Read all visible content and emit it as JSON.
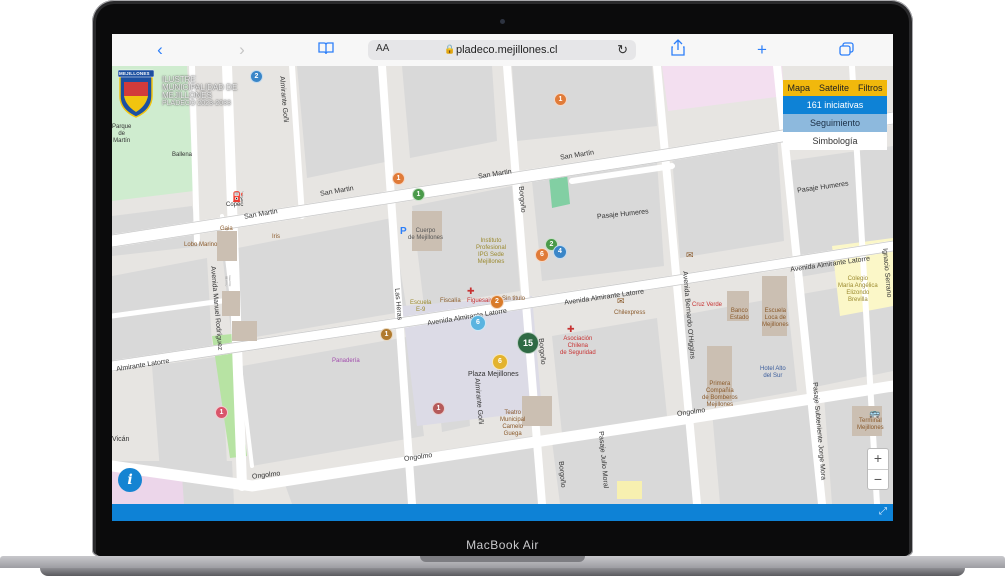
{
  "browser": {
    "url_host": "pladeco.mejillones.cl",
    "text_size_label": "AA"
  },
  "device": {
    "brand": "MacBook Air"
  },
  "logo": {
    "banner": "MEJILLONES",
    "lines": [
      "ILUSTRE",
      "MUNICIPALIDAD DE",
      "MEJILLONES",
      "PLADECO 2023-2033"
    ]
  },
  "panel": {
    "tabs": [
      "Mapa",
      "Satelite",
      "Filtros"
    ],
    "initiatives": "161 iniciativas",
    "tracking": "Seguimiento",
    "legend": "Simbología"
  },
  "map": {
    "streets": {
      "san_martin_1": "San Martin",
      "san_martin_2": "San Martin",
      "san_martin_3": "San Martin",
      "san_martin_4": "San Martín",
      "pasaje_humeres_1": "Pasaje Humeres",
      "pasaje_humeres_2": "Pasaje Humeres",
      "almirante_latorre_1": "Avenida Almirante Latorre",
      "almirante_latorre_2": "Avenida Almirante Latorre",
      "almirante_latorre_3": "Avenida Almirante Latorre",
      "almirante_latorre_4": "Almirante Latorre",
      "ongolmo_1": "Ongolmo",
      "ongolmo_2": "Ongolmo",
      "ongolmo_3": "Ongolmo",
      "borgono_1": "Borgoño",
      "borgono_2": "Borgoño",
      "borgono_3": "Borgoño",
      "las_heras": "Las Heras",
      "manuel_rodriguez": "Avenida Manuel Rodríguez",
      "gorki": "Almirante Goñi",
      "almirante_goni": "Almirante Goñi",
      "bernardo_ohiggins": "Avenida Bernardo O'Higgins",
      "julio_moral": "Pasaje Julio Moral",
      "subteniente": "Pasaje Subteniente Jorge Mora",
      "ignacio": "Ignacio Serrano",
      "vican": "Vicán"
    },
    "pois": {
      "parque": "Parque\nde\nMartín",
      "ballena": "Ballena",
      "copec": "Copec",
      "gaia": "Gaia",
      "lobo_marino": "Lobo Marino",
      "iris": "Iris",
      "instituto": "Instituto\nProfesional\nIPG Sede\nMejillones",
      "escuela": "Escuela\nE-9",
      "fiscalia": "Fiscalía",
      "figuesain": "Figuesain",
      "sin_titulo": "Sin titulo",
      "chilexpress": "Chilexpress",
      "cruz_verde": "Cruz Verde",
      "banco_estado": "Banco\nEstado",
      "escuela_loca": "Escuela\nLoca de\nMejillones",
      "colegio": "Colegio\nMaría Angélica\nElizondo\nBrevilla",
      "asociacion": "Asociación\nChilena\nde Seguridad",
      "panaderia": "Panadería",
      "plaza": "Plaza Mejillones",
      "teatro": "Teatro\nMunicipal\nCamelo\nGuega",
      "bomberos": "Primera\nCompañía\nde Bomberos\nMejillones",
      "hotel": "Hotel Alto\ndel Sur",
      "terminal": "Terminal\nMejillones",
      "cuerpo": "Cuerpo\nde Mejillones"
    },
    "markers": [
      {
        "label": "2",
        "color": "#3a86c8"
      },
      {
        "label": "1",
        "color": "#e07b39"
      },
      {
        "label": "1",
        "color": "#e07b39"
      },
      {
        "label": "1",
        "color": "#4a9a4a"
      },
      {
        "label": "2",
        "color": "#4a9a4a"
      },
      {
        "label": "6",
        "color": "#e07b39"
      },
      {
        "label": "4",
        "color": "#3a86c8"
      },
      {
        "label": "2",
        "color": "#d97b2a"
      },
      {
        "label": "6",
        "color": "#5ab4e0"
      },
      {
        "label": "1",
        "color": "#b07a2e"
      },
      {
        "label": "15",
        "color": "#2f6a44"
      },
      {
        "label": "6",
        "color": "#e3b32e"
      },
      {
        "label": "1",
        "color": "#d9566a"
      },
      {
        "label": "1",
        "color": "#b55a5a"
      }
    ]
  },
  "controls": {
    "info": "i",
    "zoom_in": "+",
    "zoom_out": "−",
    "fullscreen": "⤢"
  }
}
